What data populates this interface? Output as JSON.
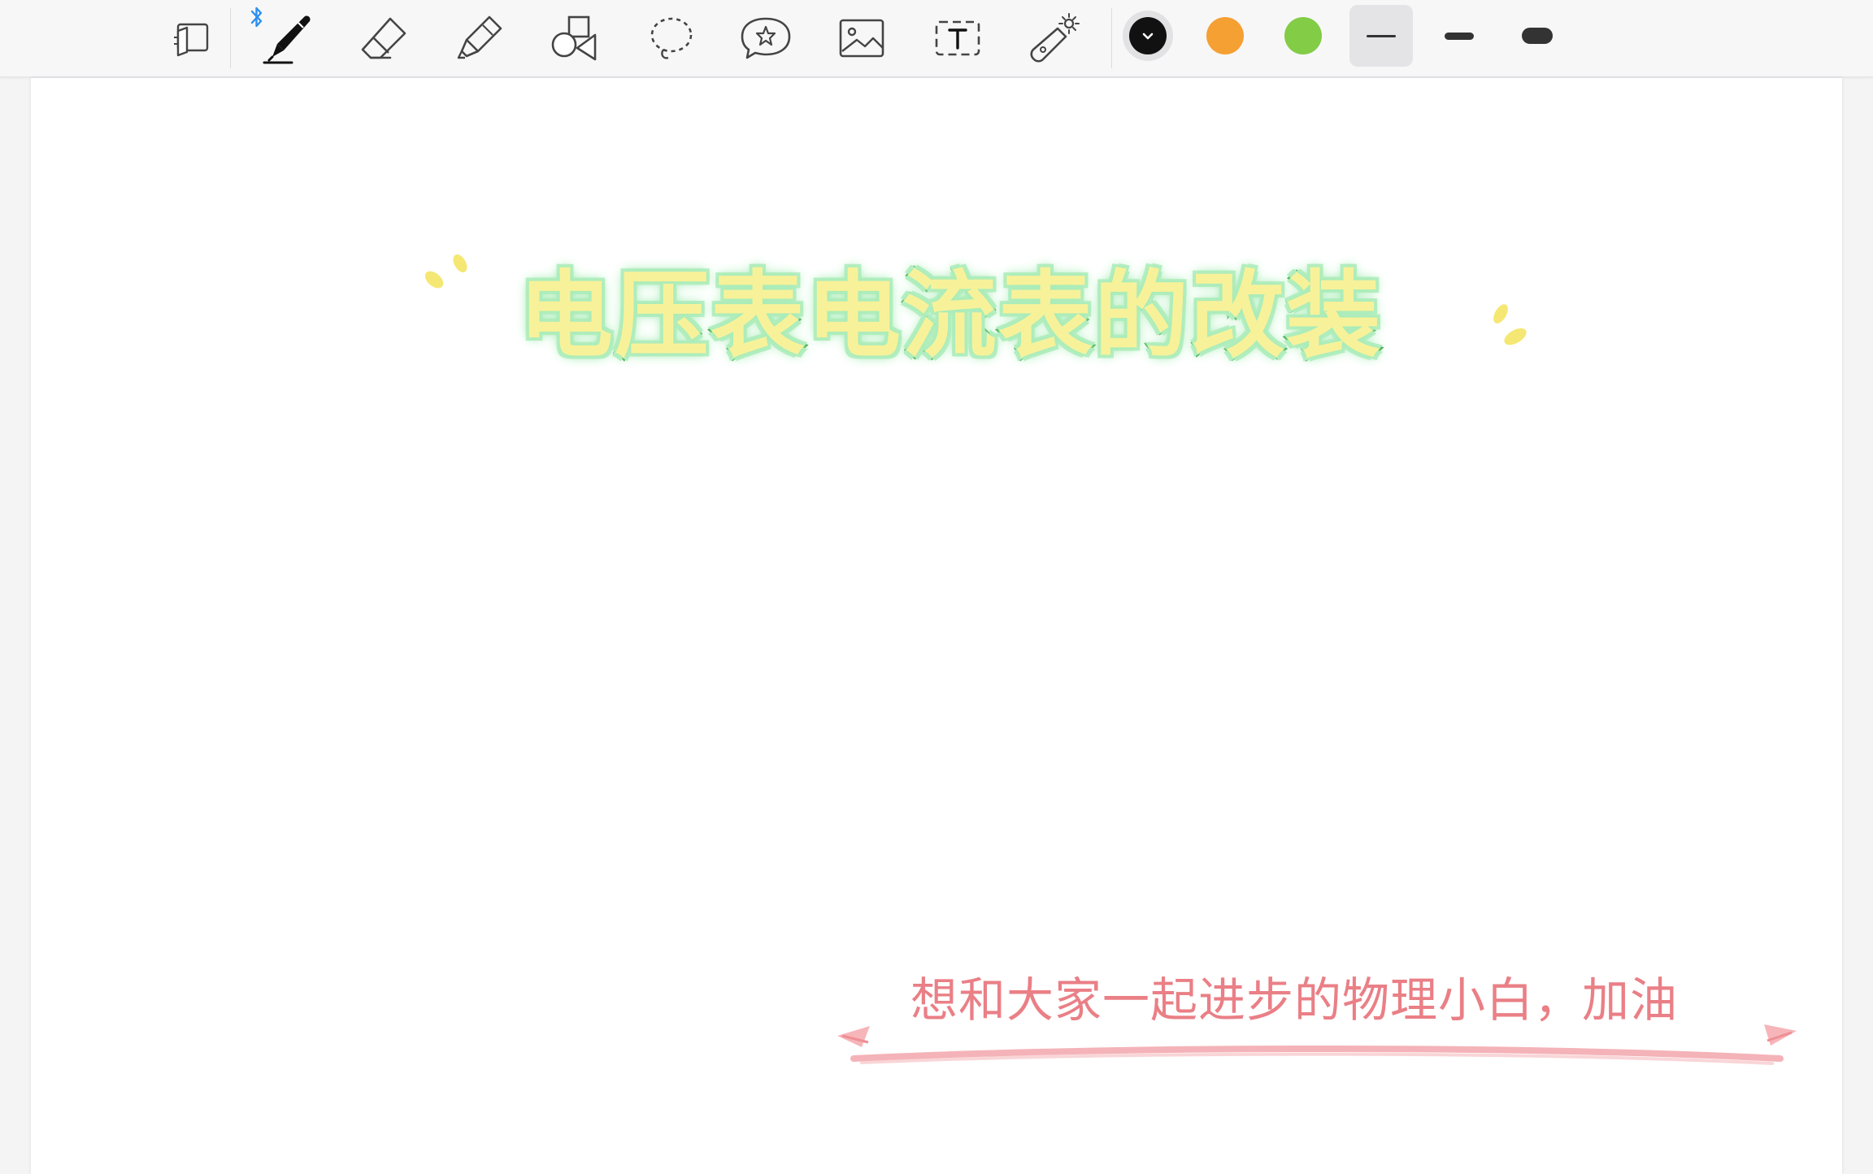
{
  "toolbar": {
    "tools": [
      {
        "name": "page-view-tool",
        "icon": "page-view-icon"
      },
      {
        "name": "pen-tool",
        "icon": "pen-icon",
        "active": true
      },
      {
        "name": "eraser-tool",
        "icon": "eraser-icon"
      },
      {
        "name": "highlighter-tool",
        "icon": "highlighter-icon"
      },
      {
        "name": "shapes-tool",
        "icon": "shapes-icon"
      },
      {
        "name": "lasso-tool",
        "icon": "lasso-icon"
      },
      {
        "name": "sticker-tool",
        "icon": "sticker-icon"
      },
      {
        "name": "image-tool",
        "icon": "image-icon"
      },
      {
        "name": "text-tool",
        "icon": "text-icon"
      },
      {
        "name": "laser-pointer-tool",
        "icon": "laser-pointer-icon"
      }
    ],
    "bluetooth_icon": "bluetooth-icon",
    "colors": [
      {
        "name": "black",
        "hex": "#111111",
        "selected": true
      },
      {
        "name": "orange",
        "hex": "#f5a033"
      },
      {
        "name": "green",
        "hex": "#82cc46"
      }
    ],
    "stroke_widths": [
      "thin",
      "medium",
      "thick"
    ],
    "selected_stroke": "thin"
  },
  "page": {
    "title": "电压表电流表的改装",
    "title_colors": {
      "fill": "#f7f29a",
      "outline": "#2f9e3a",
      "glow": "#a8ebb6"
    },
    "banner_text": "想和大家一起进步的物理小白，加油",
    "banner_color": "#ea7f86",
    "sparkle_color": "#f3e35a"
  }
}
